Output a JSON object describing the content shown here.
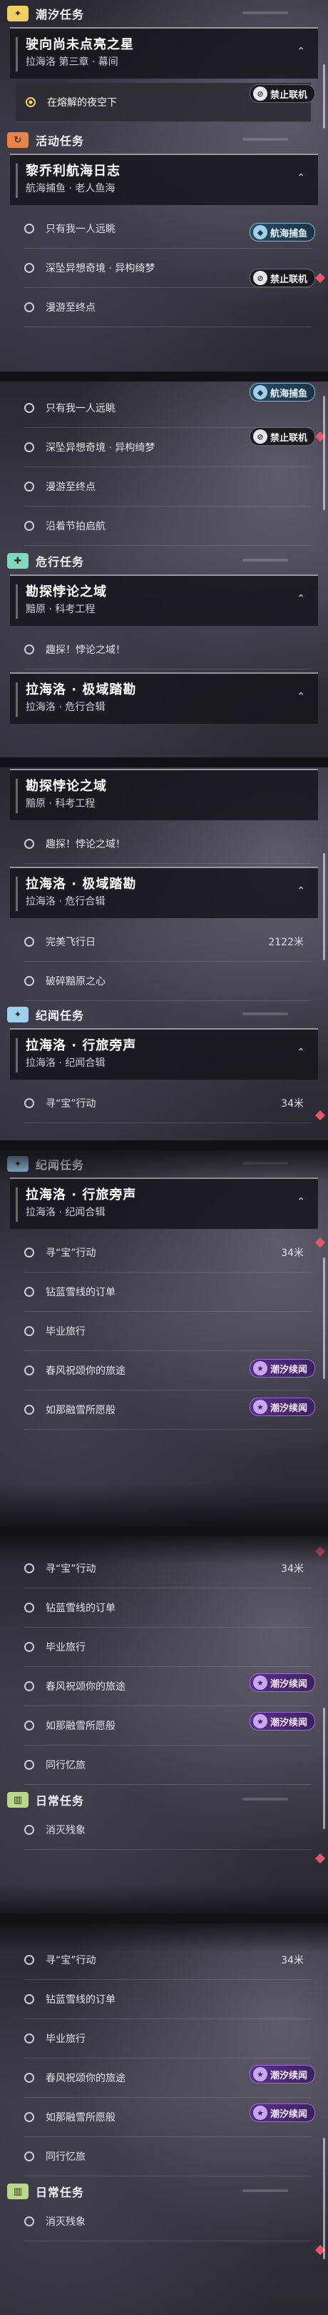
{
  "sections": {
    "chaoxi": {
      "title": "潮汐任务",
      "icon": "✦",
      "color": "#f0d060"
    },
    "event": {
      "title": "活动任务",
      "icon": "↻",
      "color": "#e8844a"
    },
    "danger": {
      "title": "危行任务",
      "icon": "✚",
      "color": "#7fd8c0"
    },
    "wenji": {
      "title": "纪闻任务",
      "icon": "✦",
      "color": "#9fd0f0"
    },
    "daily": {
      "title": "日常任务",
      "icon": "▥",
      "color": "#b8d88a"
    }
  },
  "quests": {
    "main": {
      "title": "驶向尚未点亮之星",
      "subtitle": "拉海洛 第三章 · 幕间"
    },
    "navigation": {
      "title": "黎乔利航海日志",
      "subtitle": "航海捕鱼 · 老人鱼海"
    },
    "explore": {
      "title": "勘探悖论之域",
      "subtitle": "黯原 · 科考工程"
    },
    "extreme": {
      "title": "拉海洛 · 极域踏勘",
      "subtitle": "拉海洛 · 危行合辑"
    },
    "travel": {
      "title": "拉海洛 · 行旅旁声",
      "subtitle": "拉海洛 · 纪闻合辑"
    }
  },
  "tasks": {
    "night_sky": "在熔解的夜空下",
    "alone": "只有我一人远眺",
    "deep_sea": "深坠异想奇境 · 异构绮梦",
    "drift": "漫游至终点",
    "rhythm": "沿着节拍启航",
    "paradox": "趣探！悖论之域！",
    "flight": "完美飞行日",
    "flight_dist": "2122米",
    "core": "破碎黯原之心",
    "treasure": "寻“宝”行动",
    "treasure_dist": "34米",
    "snow_order": "钻蓝雪线的订单",
    "graduate": "毕业旅行",
    "spring": "春风祝颂你的旅途",
    "snow_wish": "如那融雪所愿般",
    "company": "同行忆旅",
    "vanish": "消灭残象"
  },
  "badges": {
    "no_coop": "禁止联机",
    "fishing": "航海捕鱼",
    "chaoxi_story": "潮汐续闻"
  },
  "icons": {
    "badge_coop": "person-slash-icon",
    "badge_fish": "fish-icon",
    "badge_story": "star-icon",
    "chevron": "chevron-up-icon"
  }
}
